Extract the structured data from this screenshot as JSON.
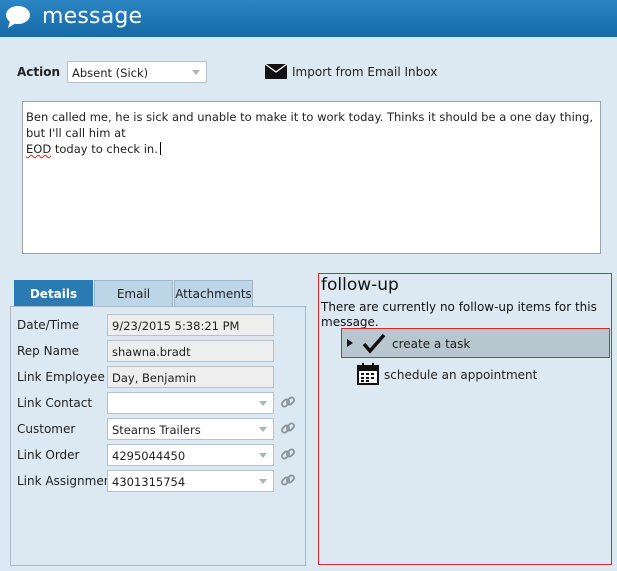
{
  "window": {
    "title": "message",
    "icon": "speech-bubble-icon"
  },
  "action": {
    "label": "Action",
    "selected": "Absent (Sick)"
  },
  "import": {
    "label": "Import from Email Inbox",
    "icon": "envelope-icon"
  },
  "message": {
    "text_part1": "Ben called me, he is sick and unable to make it to work today. Thinks it should be a one day thing, but I'll call him at",
    "text_word": "EOD",
    "text_part2": " today to check in."
  },
  "tabs": [
    {
      "label": "Details",
      "active": true
    },
    {
      "label": "Email",
      "active": false
    },
    {
      "label": "Attachments",
      "active": false
    }
  ],
  "details": {
    "date_time": {
      "label": "Date/Time",
      "value": "9/23/2015 5:38:21 PM"
    },
    "rep_name": {
      "label": "Rep Name",
      "value": "shawna.bradt"
    },
    "link_employee": {
      "label": "Link Employee",
      "value": "Day, Benjamin"
    },
    "link_contact": {
      "label": "Link Contact",
      "value": ""
    },
    "customer": {
      "label": "Customer",
      "value": "Stearns Trailers"
    },
    "link_order": {
      "label": "Link Order",
      "value": "4295044450"
    },
    "link_assignment": {
      "label": "Link Assignment",
      "value": "4301315754"
    }
  },
  "followup": {
    "title": "follow-up",
    "empty_text": "There are currently no follow-up items for this message.",
    "create_task": {
      "label": "create a task",
      "icon": "checkmark-icon"
    },
    "schedule": {
      "label": "schedule an appointment",
      "icon": "calendar-icon"
    }
  },
  "colors": {
    "accent": "#1f75b3",
    "highlight_border": "#d62b2b",
    "background": "#dce9f3"
  }
}
